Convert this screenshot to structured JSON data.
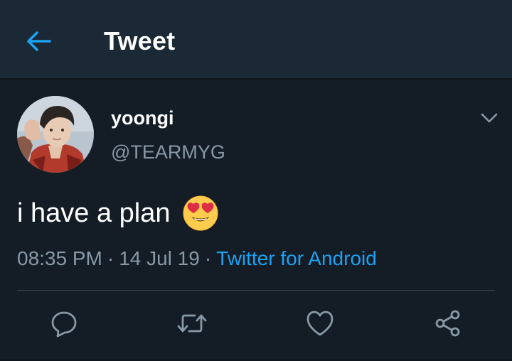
{
  "header": {
    "title": "Tweet",
    "back_icon": "arrow-left-icon",
    "accent_color": "#1da1f2"
  },
  "tweet": {
    "author": {
      "display_name": "yoongi",
      "handle": "@TEARMYG"
    },
    "text": "i have a plan",
    "emoji": "heart-eyes-emoji",
    "time": "08:35 PM",
    "separator": "·",
    "date": "14 Jul 19",
    "source": "Twitter for Android",
    "menu_icon": "chevron-down-icon"
  },
  "actions": [
    {
      "name": "reply",
      "icon": "reply-icon"
    },
    {
      "name": "retweet",
      "icon": "retweet-icon"
    },
    {
      "name": "like",
      "icon": "heart-icon"
    },
    {
      "name": "share",
      "icon": "share-icon"
    }
  ],
  "colors": {
    "background": "#141d26",
    "header_background": "#1b2836",
    "secondary_text": "#8899a6",
    "link": "#1da1f2"
  }
}
